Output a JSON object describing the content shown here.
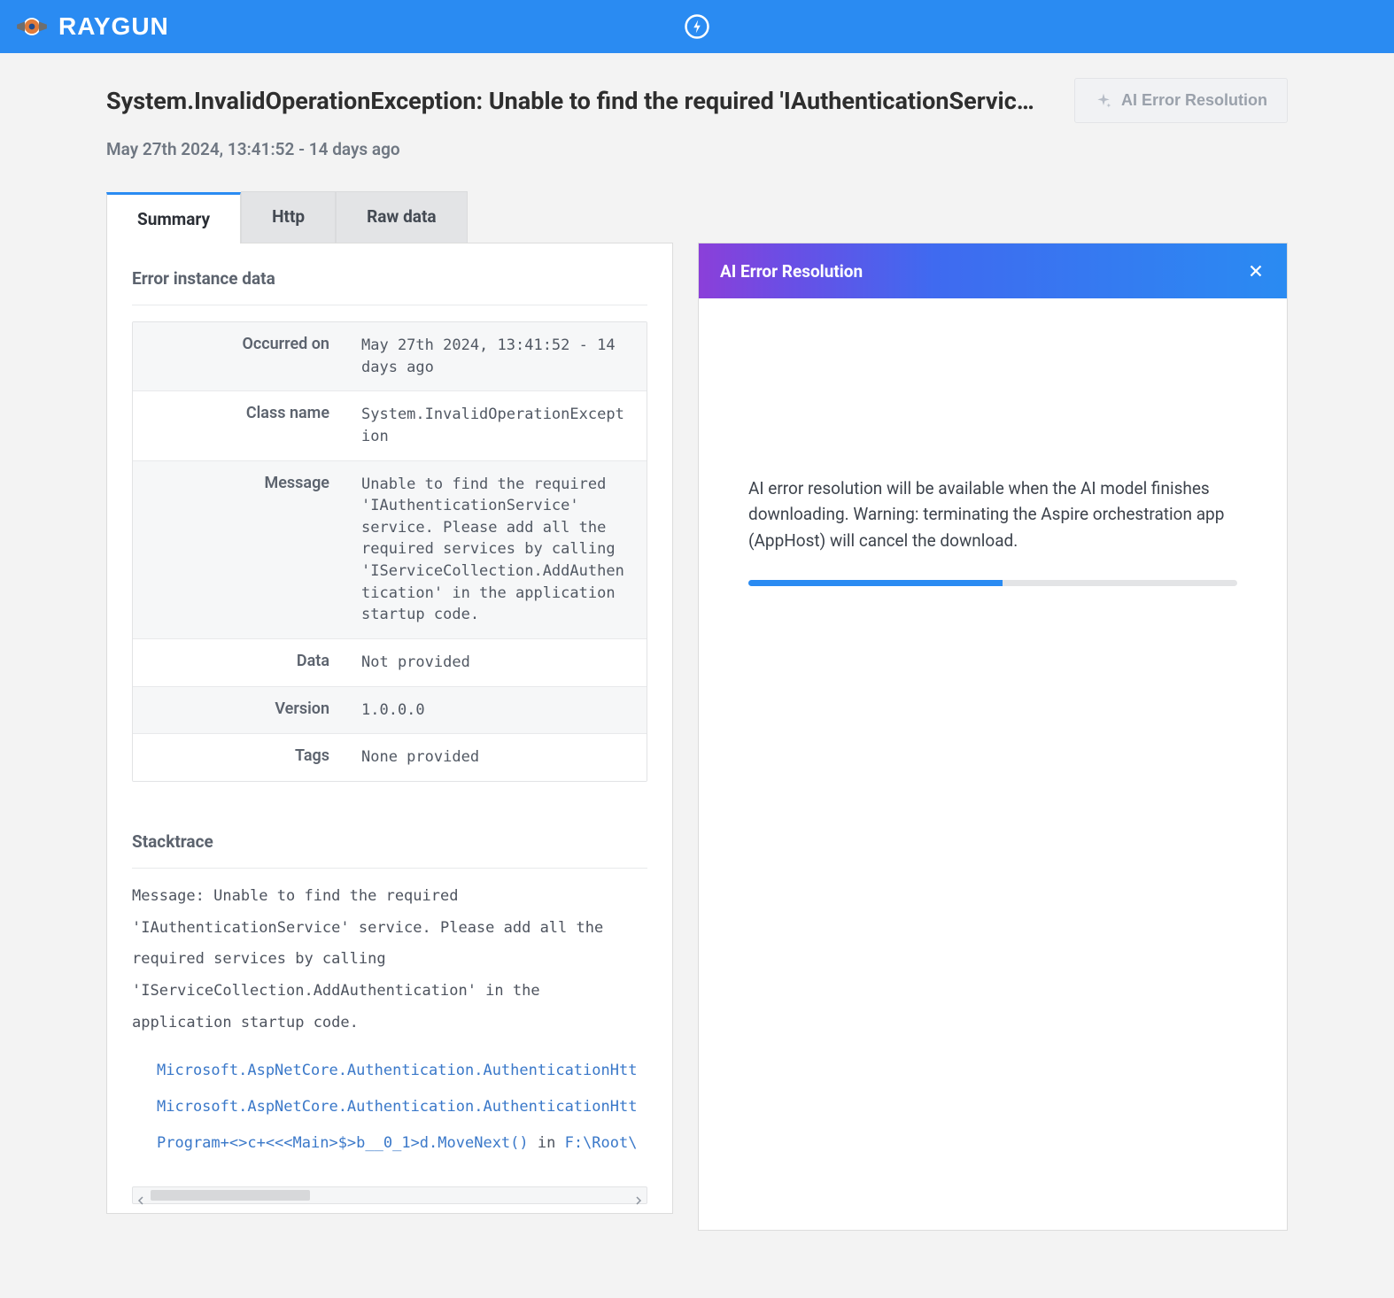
{
  "brand": {
    "name": "RAYGUN"
  },
  "header": {
    "title": "System.InvalidOperationException: Unable to find the required 'IAuthenticationServic…",
    "ai_button_label": "AI Error Resolution",
    "timestamp": "May 27th 2024, 13:41:52 - 14 days ago"
  },
  "tabs": {
    "items": [
      {
        "label": "Summary",
        "active": true
      },
      {
        "label": "Http",
        "active": false
      },
      {
        "label": "Raw data",
        "active": false
      }
    ]
  },
  "error_instance": {
    "section_title": "Error instance data",
    "rows": [
      {
        "label": "Occurred on",
        "value": "May 27th 2024, 13:41:52 - 14 days ago"
      },
      {
        "label": "Class name",
        "value": "System.InvalidOperationException"
      },
      {
        "label": "Message",
        "value": "Unable to find the required 'IAuthenticationService' service. Please add all the required services by calling 'IServiceCollection.AddAuthentication' in the application startup code."
      },
      {
        "label": "Data",
        "value": "Not provided"
      },
      {
        "label": "Version",
        "value": "1.0.0.0"
      },
      {
        "label": "Tags",
        "value": "None provided"
      }
    ]
  },
  "stacktrace": {
    "section_title": "Stacktrace",
    "message_prefix": "Message: ",
    "message": "Unable to find the required 'IAuthenticationService' service. Please add all the required services by calling 'IServiceCollection.AddAuthentication' in the application startup code.",
    "frames": [
      {
        "text": "Microsoft.AspNetCore.Authentication.AuthenticationHtt"
      },
      {
        "text": "Microsoft.AspNetCore.Authentication.AuthenticationHtt"
      },
      {
        "text": "Program+<>c+<<<Main>$>b__0_1>d.MoveNext()",
        "in": " in ",
        "path": "F:\\Root\\"
      }
    ]
  },
  "ai_panel": {
    "title": "AI Error Resolution",
    "message": "AI error resolution will be available when the AI model finishes downloading. Warning: terminating the Aspire orchestration app (AppHost) will cancel the download.",
    "progress_percent": 52
  }
}
